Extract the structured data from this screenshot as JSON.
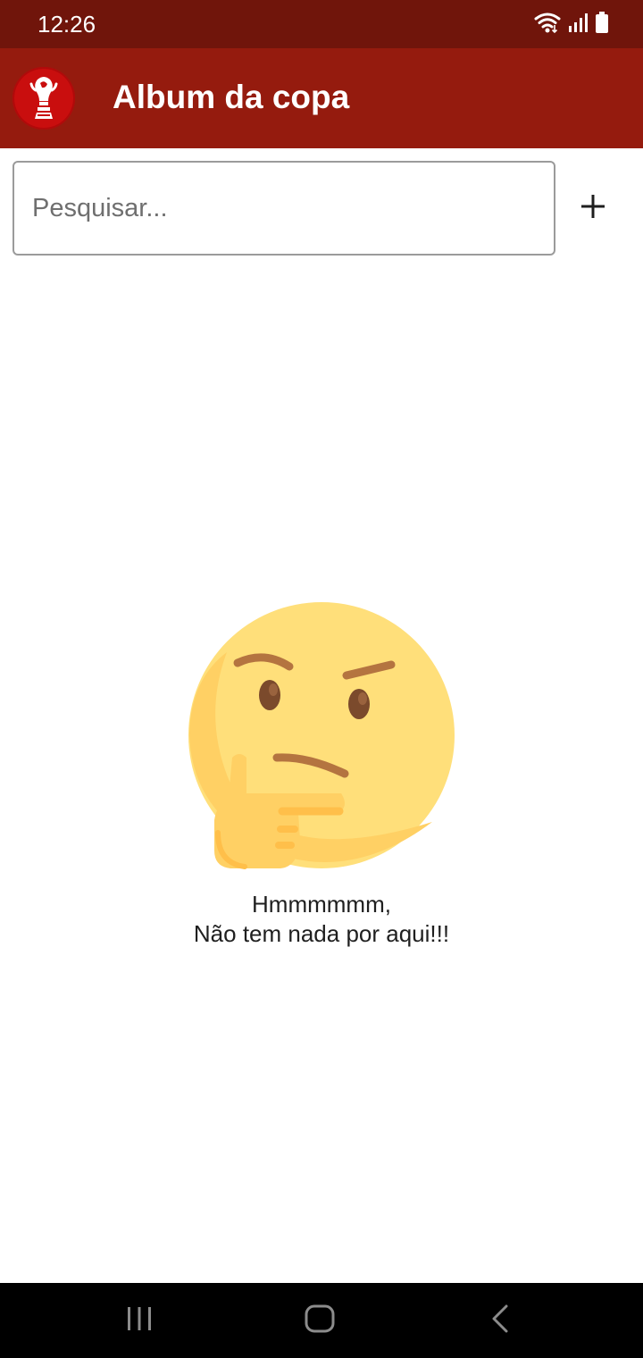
{
  "status_bar": {
    "time": "12:26"
  },
  "app_bar": {
    "title": "Album da copa",
    "logo_icon": "trophy-icon",
    "color": "#951b0e",
    "status_color": "#70150b",
    "logo_color": "#c90e0e"
  },
  "search": {
    "placeholder": "Pesquisar...",
    "value": ""
  },
  "add_button": {
    "icon": "plus-icon"
  },
  "empty_state": {
    "icon": "thinking-face-icon",
    "line1": "Hmmmmmm,",
    "line2": "Não tem nada por aqui!!!"
  },
  "nav_bar": {
    "items": [
      "recent-apps-icon",
      "home-icon",
      "back-icon"
    ]
  }
}
